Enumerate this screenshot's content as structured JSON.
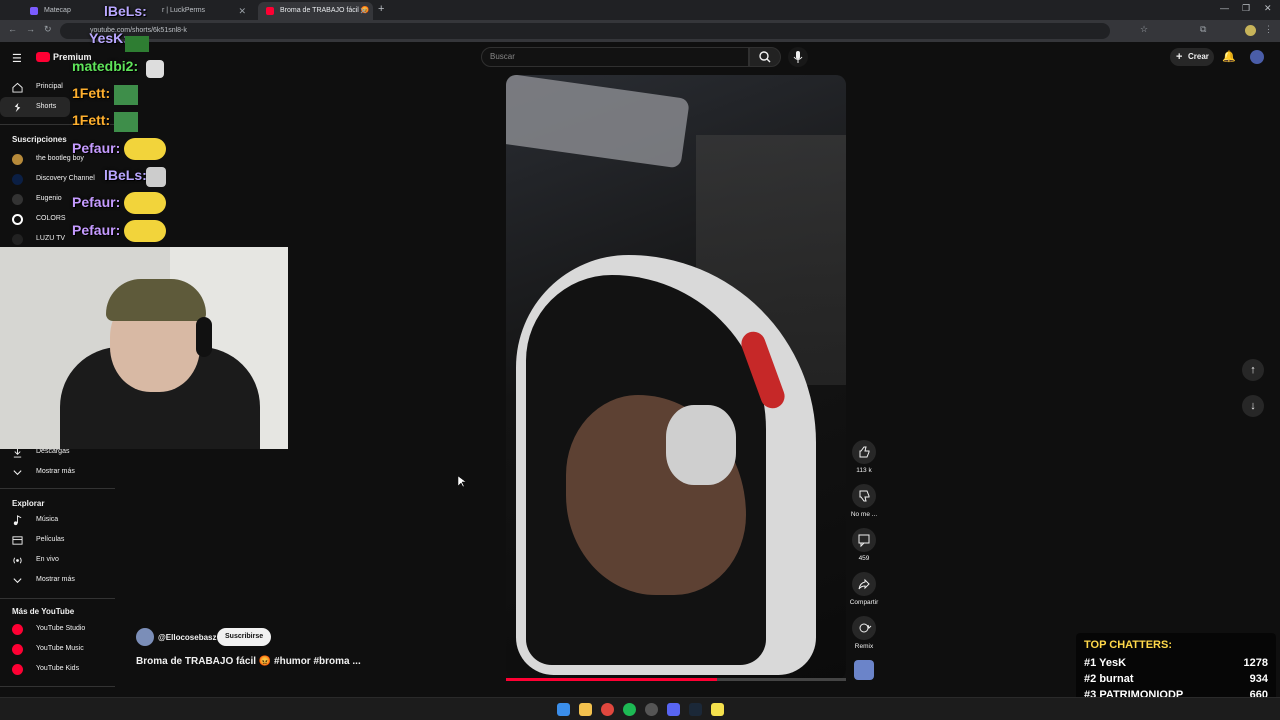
{
  "browser": {
    "tabs": [
      {
        "label": "Matecap",
        "active": false
      },
      {
        "label": "r | LuckPerms",
        "active": false
      },
      {
        "label": "Broma de TRABAJO fácil 😡",
        "active": true
      }
    ],
    "url": "youtube.com/shorts/6k51snl8-k"
  },
  "masthead": {
    "logo_label": "Premium",
    "search_placeholder": "Buscar",
    "create_label": "Crear"
  },
  "sidebar": {
    "nav": [
      {
        "label": "Principal",
        "icon": "home-icon"
      },
      {
        "label": "Shorts",
        "icon": "shorts-icon"
      }
    ],
    "subs_title": "Suscripciones",
    "subs": [
      {
        "label": "the bootleg boy"
      },
      {
        "label": "Discovery Channel"
      },
      {
        "label": "Eugenio"
      },
      {
        "label": "COLORS"
      },
      {
        "label": "LUZU TV"
      }
    ],
    "you_items": [
      {
        "label": "Descargas",
        "icon": "download-icon"
      },
      {
        "label": "Mostrar más",
        "icon": "chevron-down-icon"
      }
    ],
    "explore_title": "Explorar",
    "explore": [
      {
        "label": "Música",
        "icon": "music-icon"
      },
      {
        "label": "Películas",
        "icon": "film-icon"
      },
      {
        "label": "En vivo",
        "icon": "live-icon"
      },
      {
        "label": "Mostrar más",
        "icon": "chevron-down-icon"
      }
    ],
    "more_title": "Más de YouTube",
    "more": [
      {
        "label": "YouTube Studio"
      },
      {
        "label": "YouTube Music"
      },
      {
        "label": "YouTube Kids"
      }
    ]
  },
  "short": {
    "channel": "@Ellocosebasz",
    "subscribe_label": "Suscribirse",
    "title": "Broma de TRABAJO fácil 😡 #humor #broma ...",
    "likes": "113 k",
    "dislike_label": "No me ...",
    "comments": "459",
    "share_label": "Compartir",
    "remix_label": "Remix",
    "progress": 0.62
  },
  "chat": [
    {
      "user": "lBeLs:",
      "color": "#b9a7ff"
    },
    {
      "user": "YesK:",
      "color": "#b9a7ff"
    },
    {
      "user": "matedbi2:",
      "color": "#5fe35a"
    },
    {
      "user": "1Fett:",
      "color": "#ffb02e"
    },
    {
      "user": "1Fett:",
      "color": "#ffb02e"
    },
    {
      "user": "Pefaur:",
      "color": "#c59bff"
    },
    {
      "user": "lBeLs:",
      "color": "#b9a7ff"
    },
    {
      "user": "Pefaur:",
      "color": "#c59bff"
    },
    {
      "user": "Pefaur:",
      "color": "#c59bff"
    }
  ],
  "top_chatters": {
    "title": "TOP CHATTERS:",
    "rows": [
      {
        "rank": "#1",
        "name": "YesK",
        "score": "1278"
      },
      {
        "rank": "#2",
        "name": "burnat",
        "score": "934"
      },
      {
        "rank": "#3",
        "name": "PATRIMONIODP",
        "score": "660"
      }
    ]
  },
  "colors": {
    "accent": "#ff0033",
    "bg": "#0f0f0f"
  }
}
